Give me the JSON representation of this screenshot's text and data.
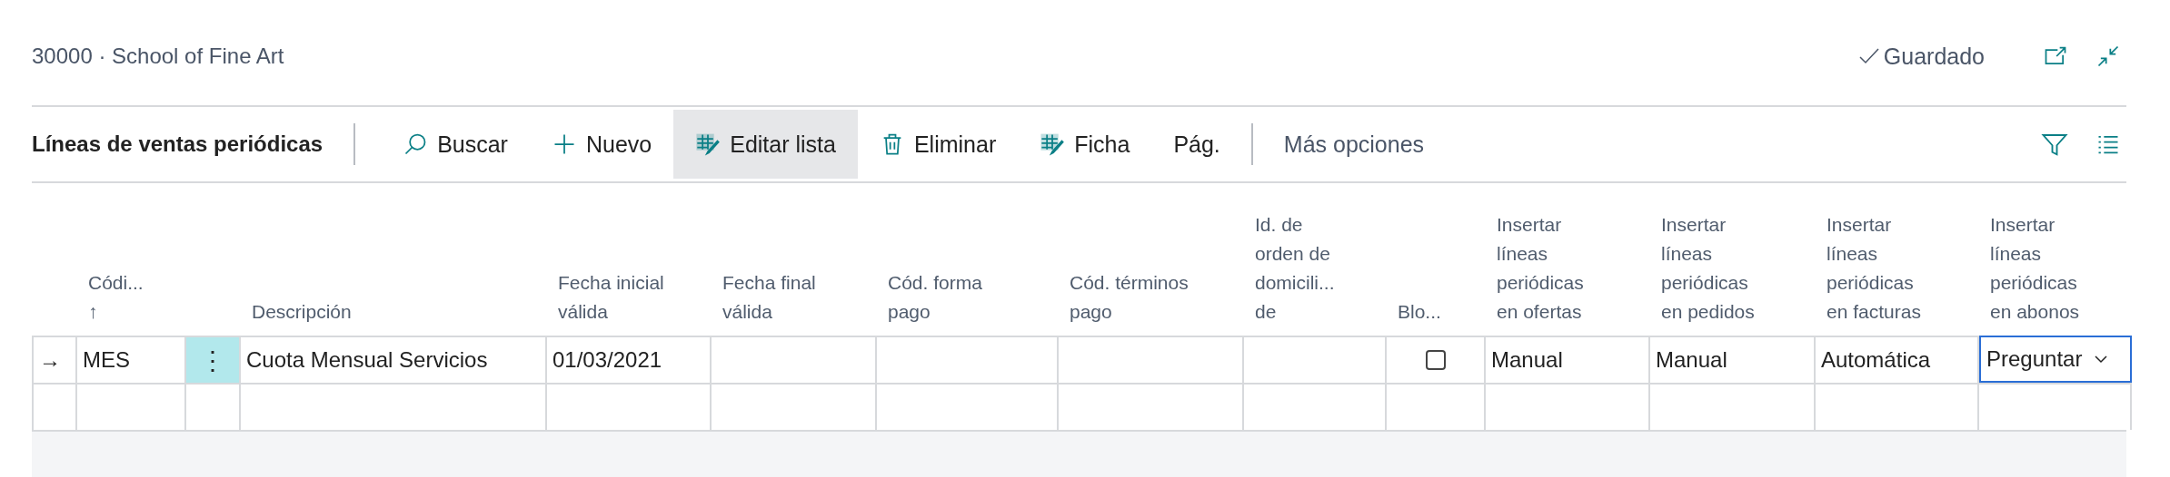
{
  "header": {
    "title": "30000 · School of Fine Art",
    "status": "Guardado"
  },
  "toolbar": {
    "title": "Líneas de ventas periódicas",
    "actions": [
      {
        "label": "Buscar",
        "kind": "search",
        "selected": false
      },
      {
        "label": "Nuevo",
        "kind": "new",
        "selected": false
      },
      {
        "label": "Editar lista",
        "kind": "edit",
        "selected": true
      },
      {
        "label": "Eliminar",
        "kind": "delete",
        "selected": false
      },
      {
        "label": "Ficha",
        "kind": "card",
        "selected": false
      },
      {
        "label": "Pág.",
        "kind": "plain",
        "selected": false
      }
    ],
    "more": "Más opciones"
  },
  "table": {
    "columns": [
      {
        "kind": "indicator"
      },
      {
        "kind": "field",
        "label": "Códi...",
        "sort": "↑"
      },
      {
        "kind": "menu"
      },
      {
        "kind": "field",
        "label": "Descripción"
      },
      {
        "kind": "field",
        "label": "Fecha inicial\nválida"
      },
      {
        "kind": "field",
        "label": "Fecha final\nválida"
      },
      {
        "kind": "field",
        "label": "Cód. forma\npago"
      },
      {
        "kind": "field",
        "label": "Cód. términos\npago"
      },
      {
        "kind": "field",
        "label": "Id. de\norden de\ndomicili...\nde"
      },
      {
        "kind": "field",
        "label": "Blo..."
      },
      {
        "kind": "field",
        "label": "Insertar\nlíneas\nperiódicas\nen ofertas"
      },
      {
        "kind": "field",
        "label": "Insertar\nlíneas\nperiódicas\nen pedidos"
      },
      {
        "kind": "field",
        "label": "Insertar\nlíneas\nperiódicas\nen facturas"
      },
      {
        "kind": "field",
        "label": "Insertar\nlíneas\nperiódicas\nen abonos"
      }
    ],
    "rows": [
      {
        "cells": [
          {
            "kind": "indicator",
            "value": "→"
          },
          {
            "kind": "text",
            "value": "MES"
          },
          {
            "kind": "menu",
            "value": "⋮",
            "selected": true
          },
          {
            "kind": "text",
            "value": "Cuota Mensual Servicios"
          },
          {
            "kind": "text",
            "value": "01/03/2021"
          },
          {
            "kind": "empty"
          },
          {
            "kind": "empty"
          },
          {
            "kind": "empty"
          },
          {
            "kind": "empty"
          },
          {
            "kind": "checkbox",
            "checked": false
          },
          {
            "kind": "text",
            "value": "Manual"
          },
          {
            "kind": "text",
            "value": "Manual"
          },
          {
            "kind": "text",
            "value": "Automática"
          },
          {
            "kind": "select",
            "value": "Preguntar",
            "focused": true
          }
        ]
      },
      {
        "cells": [
          {
            "kind": "empty"
          },
          {
            "kind": "empty"
          },
          {
            "kind": "empty"
          },
          {
            "kind": "empty"
          },
          {
            "kind": "empty"
          },
          {
            "kind": "empty"
          },
          {
            "kind": "empty"
          },
          {
            "kind": "empty"
          },
          {
            "kind": "empty"
          },
          {
            "kind": "empty"
          },
          {
            "kind": "empty"
          },
          {
            "kind": "empty"
          },
          {
            "kind": "empty"
          },
          {
            "kind": "empty"
          }
        ]
      }
    ]
  }
}
